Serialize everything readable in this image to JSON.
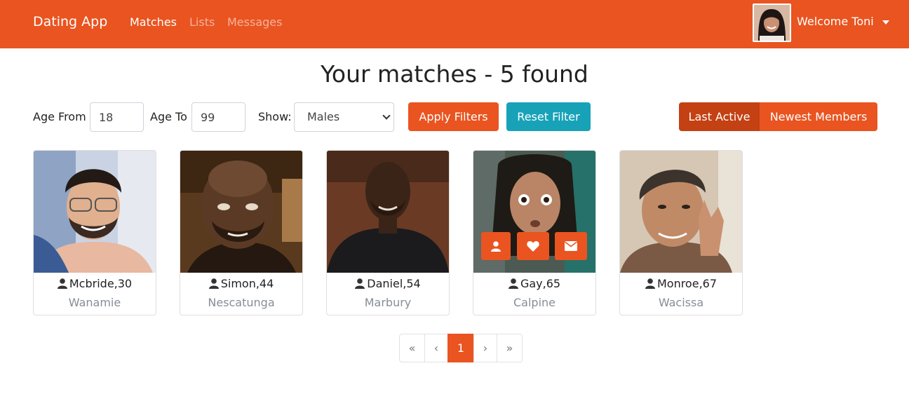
{
  "navbar": {
    "brand": "Dating App",
    "links": [
      {
        "label": "Matches"
      },
      {
        "label": "Lists"
      },
      {
        "label": "Messages"
      }
    ],
    "welcome": "Welcome Toni",
    "accent_color": "#e95420"
  },
  "title": "Your matches - 5 found",
  "filters": {
    "age_from_label": "Age From",
    "age_from_value": "18",
    "age_to_label": "Age To",
    "age_to_value": "99",
    "show_label": "Show:",
    "show_selected": "Males",
    "apply_label": "Apply Filters",
    "reset_label": "Reset Filter",
    "sort_last_active": "Last Active",
    "sort_newest": "Newest Members"
  },
  "members": [
    {
      "name": "Mcbride,30",
      "city": "Wanamie"
    },
    {
      "name": "Simon,44",
      "city": "Nescatunga"
    },
    {
      "name": "Daniel,54",
      "city": "Marbury"
    },
    {
      "name": "Gay,65",
      "city": "Calpine"
    },
    {
      "name": "Monroe,67",
      "city": "Wacissa"
    }
  ],
  "card_actions": [
    "user-icon",
    "heart-icon",
    "envelope-icon"
  ],
  "pagination": {
    "first": "«",
    "prev": "‹",
    "current": "1",
    "next": "›",
    "last": "»"
  }
}
